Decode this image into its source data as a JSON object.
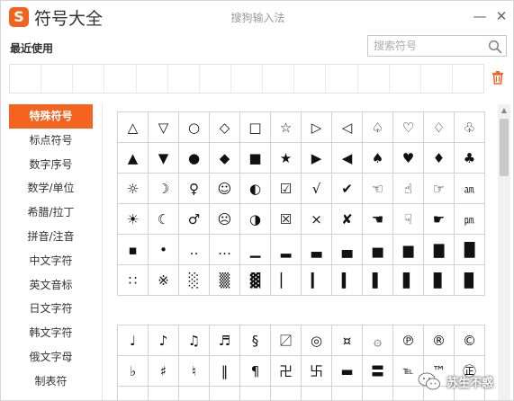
{
  "window": {
    "logo_letter": "S",
    "title": "符号大全",
    "ime_name": "搜狗输入法",
    "minimize_label": "—",
    "close_label": "✕"
  },
  "recent": {
    "label": "最近使用",
    "cell_count": 15
  },
  "search": {
    "placeholder": "搜索符号",
    "value": ""
  },
  "sidebar": {
    "items": [
      {
        "label": "特殊符号",
        "active": true
      },
      {
        "label": "标点符号",
        "active": false
      },
      {
        "label": "数字序号",
        "active": false
      },
      {
        "label": "数学/单位",
        "active": false
      },
      {
        "label": "希腊/拉丁",
        "active": false
      },
      {
        "label": "拼音/注音",
        "active": false
      },
      {
        "label": "中文字符",
        "active": false
      },
      {
        "label": "英文音标",
        "active": false
      },
      {
        "label": "日文字符",
        "active": false
      },
      {
        "label": "韩文字符",
        "active": false
      },
      {
        "label": "俄文字母",
        "active": false
      },
      {
        "label": "制表符",
        "active": false
      }
    ]
  },
  "symbols_section1": [
    [
      "△",
      "▽",
      "○",
      "◇",
      "□",
      "☆",
      "▷",
      "◁",
      "♤",
      "♡",
      "♢",
      "♧"
    ],
    [
      "▲",
      "▼",
      "●",
      "◆",
      "■",
      "★",
      "▶",
      "◀",
      "♠",
      "♥",
      "♦",
      "♣"
    ],
    [
      "☼",
      "☽",
      "♀",
      "☺",
      "◐",
      "☑",
      "√",
      "✔",
      "☜",
      "☝",
      "☞",
      "㏂"
    ],
    [
      "☀",
      "☾",
      "♂",
      "☹",
      "◑",
      "☒",
      "×",
      "✘",
      "☚",
      "☟",
      "☛",
      "㏘"
    ],
    [
      "▪",
      "•",
      "‥",
      "…",
      "▁",
      "▂",
      "▃",
      "▄",
      "▅",
      "▆",
      "▇",
      "█"
    ],
    [
      "∷",
      "※",
      "░",
      "▒",
      "▓",
      "▏",
      "▎",
      "▍",
      "▌",
      "▋",
      "▊",
      "▉"
    ]
  ],
  "symbols_section2": [
    [
      "♩",
      "♪",
      "♫",
      "♬",
      "§",
      "〼",
      "◎",
      "¤",
      "۞",
      "℗",
      "®",
      "©"
    ],
    [
      "♭",
      "♯",
      "♮",
      "‖",
      "¶",
      "卍",
      "卐",
      "▬",
      "〓",
      "℡",
      "™",
      "㊣"
    ],
    [
      "",
      "",
      "",
      "",
      "",
      "",
      "",
      "",
      "",
      "",
      "",
      ""
    ]
  ],
  "watermark": {
    "text": "苏生不惑"
  },
  "colors": {
    "accent": "#f5641e",
    "logo": "#f2641e",
    "grid_border": "#d2d2d2"
  },
  "icons": {
    "logo": "sogou-logo-icon",
    "search": "search-icon",
    "trash": "trash-icon",
    "scroll_up": "triangle-up-icon"
  }
}
